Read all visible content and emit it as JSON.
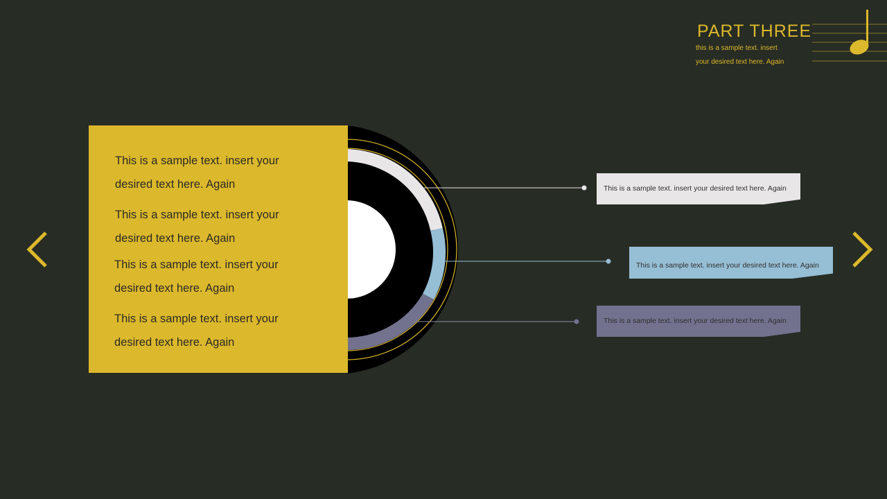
{
  "header": {
    "title": "PART  THREE",
    "subtitle_line1": "this is a sample text. insert",
    "subtitle_line2": "your desired text here. Again"
  },
  "panel": {
    "items": [
      {
        "line1": "This is a sample text. insert your",
        "line2": "desired text here. Again"
      },
      {
        "line1": "This is a sample text. insert your",
        "line2": "desired text here. Again"
      },
      {
        "line1": "This is a sample text. insert your",
        "line2": "desired text here. Again"
      },
      {
        "line1": "This is a sample text. insert your",
        "line2": "desired text here. Again"
      }
    ]
  },
  "callouts": [
    {
      "text": "This is a sample text. insert your desired text here. Again",
      "color": "#e8e6e7"
    },
    {
      "text": "This is a sample text. insert your desired text here. Again",
      "color": "#96bed5"
    },
    {
      "text": "This is a sample text. insert your desired text here. Again",
      "color": "#72728f"
    }
  ],
  "colors": {
    "background": "#272c24",
    "accent": "#dcb82c",
    "disc": "#000000"
  },
  "icons": {
    "left": "chevron-left-icon",
    "right": "chevron-right-icon",
    "note": "music-note-icon"
  }
}
